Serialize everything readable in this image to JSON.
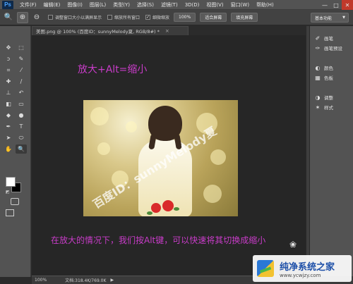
{
  "app": {
    "logo": "Ps"
  },
  "menu": [
    "文件(F)",
    "编辑(E)",
    "图像(I)",
    "图层(L)",
    "类型(Y)",
    "选择(S)",
    "滤镜(T)",
    "3D(D)",
    "视图(V)",
    "窗口(W)",
    "帮助(H)"
  ],
  "window_buttons": {
    "minimize": "—",
    "maximize": "□",
    "close": "✕"
  },
  "options": {
    "resize_windows_label": "调整窗口大小以满屏显示",
    "zoom_all_label": "缩放所有窗口",
    "scrubby_zoom_label": "细微缩放",
    "scrubby_zoom_checked": "✓",
    "zoom_100": "100%",
    "fit_screen": "适合屏幕",
    "fill_screen": "填充屏幕",
    "workspace": "基本功能"
  },
  "document": {
    "tab_title": "美图.png @ 100% (百度ID：sunnyMelody夏, RGB/8#) *",
    "tab_close": "×"
  },
  "captions": {
    "top": "放大+Alt=缩小",
    "bottom": "在放大的情况下，我们按Alt键，可以快速将其切换成缩小"
  },
  "photo": {
    "watermark": "百度ID：sunnyMelody夏"
  },
  "status": {
    "zoom": "100%",
    "doc_info": "文档:318.4K/769.0K",
    "arrow": "▶"
  },
  "panels": {
    "group1": [
      {
        "icon": "brush-preset-icon",
        "label": "画笔"
      },
      {
        "icon": "brush-preset-icon",
        "label": "画笔预设"
      }
    ],
    "group2": [
      {
        "icon": "color-icon",
        "label": "颜色"
      },
      {
        "icon": "swatches-icon",
        "label": "色板"
      }
    ],
    "group3": [
      {
        "icon": "adjustments-icon",
        "label": "调整"
      },
      {
        "icon": "styles-icon",
        "label": "样式"
      }
    ]
  },
  "brand": {
    "title": "纯净系统之家",
    "url": "www.ycwjzy.com"
  },
  "colors": {
    "caption": "#c83cc8",
    "panel_bg": "#535353",
    "canvas_bg": "#262626"
  }
}
